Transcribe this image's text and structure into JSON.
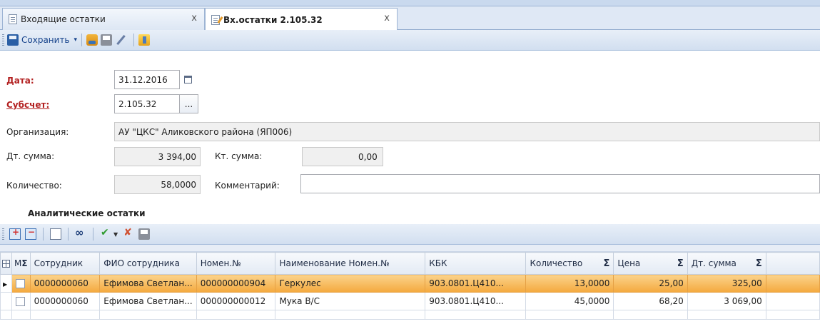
{
  "tabs": [
    {
      "label": "Входящие остатки",
      "close": "x"
    },
    {
      "label": "Вх.остатки 2.105.32",
      "close": "x"
    }
  ],
  "toolbar": {
    "save_label": "Сохранить",
    "save_dropdown": "▾"
  },
  "form": {
    "date_label": "Дата:",
    "date_value": "31.12.2016",
    "subaccount_label": "Субсчет:",
    "subaccount_value": "2.105.32",
    "subaccount_button": "...",
    "org_label": "Организация:",
    "org_value": "АУ \"ЦКС\" Аликовского района (ЯП006)",
    "debit_label": "Дт. сумма:",
    "debit_value": "3 394,00",
    "credit_label": "Кт. сумма:",
    "credit_value": "0,00",
    "qty_label": "Количество:",
    "qty_value": "58,0000",
    "comment_label": "Комментарий:",
    "comment_value": ""
  },
  "section_title": "Аналитические остатки",
  "grid": {
    "columns": [
      "Сотрудник",
      "ФИО сотрудника",
      "Номен.№",
      "Наименование Номен.№",
      "КБК",
      "Количество",
      "Цена",
      "Дт. сумма"
    ],
    "mark_col": "М",
    "sigma": "Σ",
    "rows": [
      {
        "employee": "0000000060",
        "fio": "Ефимова Светлан...",
        "nomen": "000000000904",
        "name": "Геркулес",
        "kbk": "903.0801.Ц410...",
        "qty": "13,0000",
        "price": "25,00",
        "sum": "325,00",
        "selected": true
      },
      {
        "employee": "0000000060",
        "fio": "Ефимова Светлан...",
        "nomen": "000000000012",
        "name": "Мука В/С",
        "kbk": "903.0801.Ц410...",
        "qty": "45,0000",
        "price": "68,20",
        "sum": "3 069,00",
        "selected": false
      }
    ]
  }
}
